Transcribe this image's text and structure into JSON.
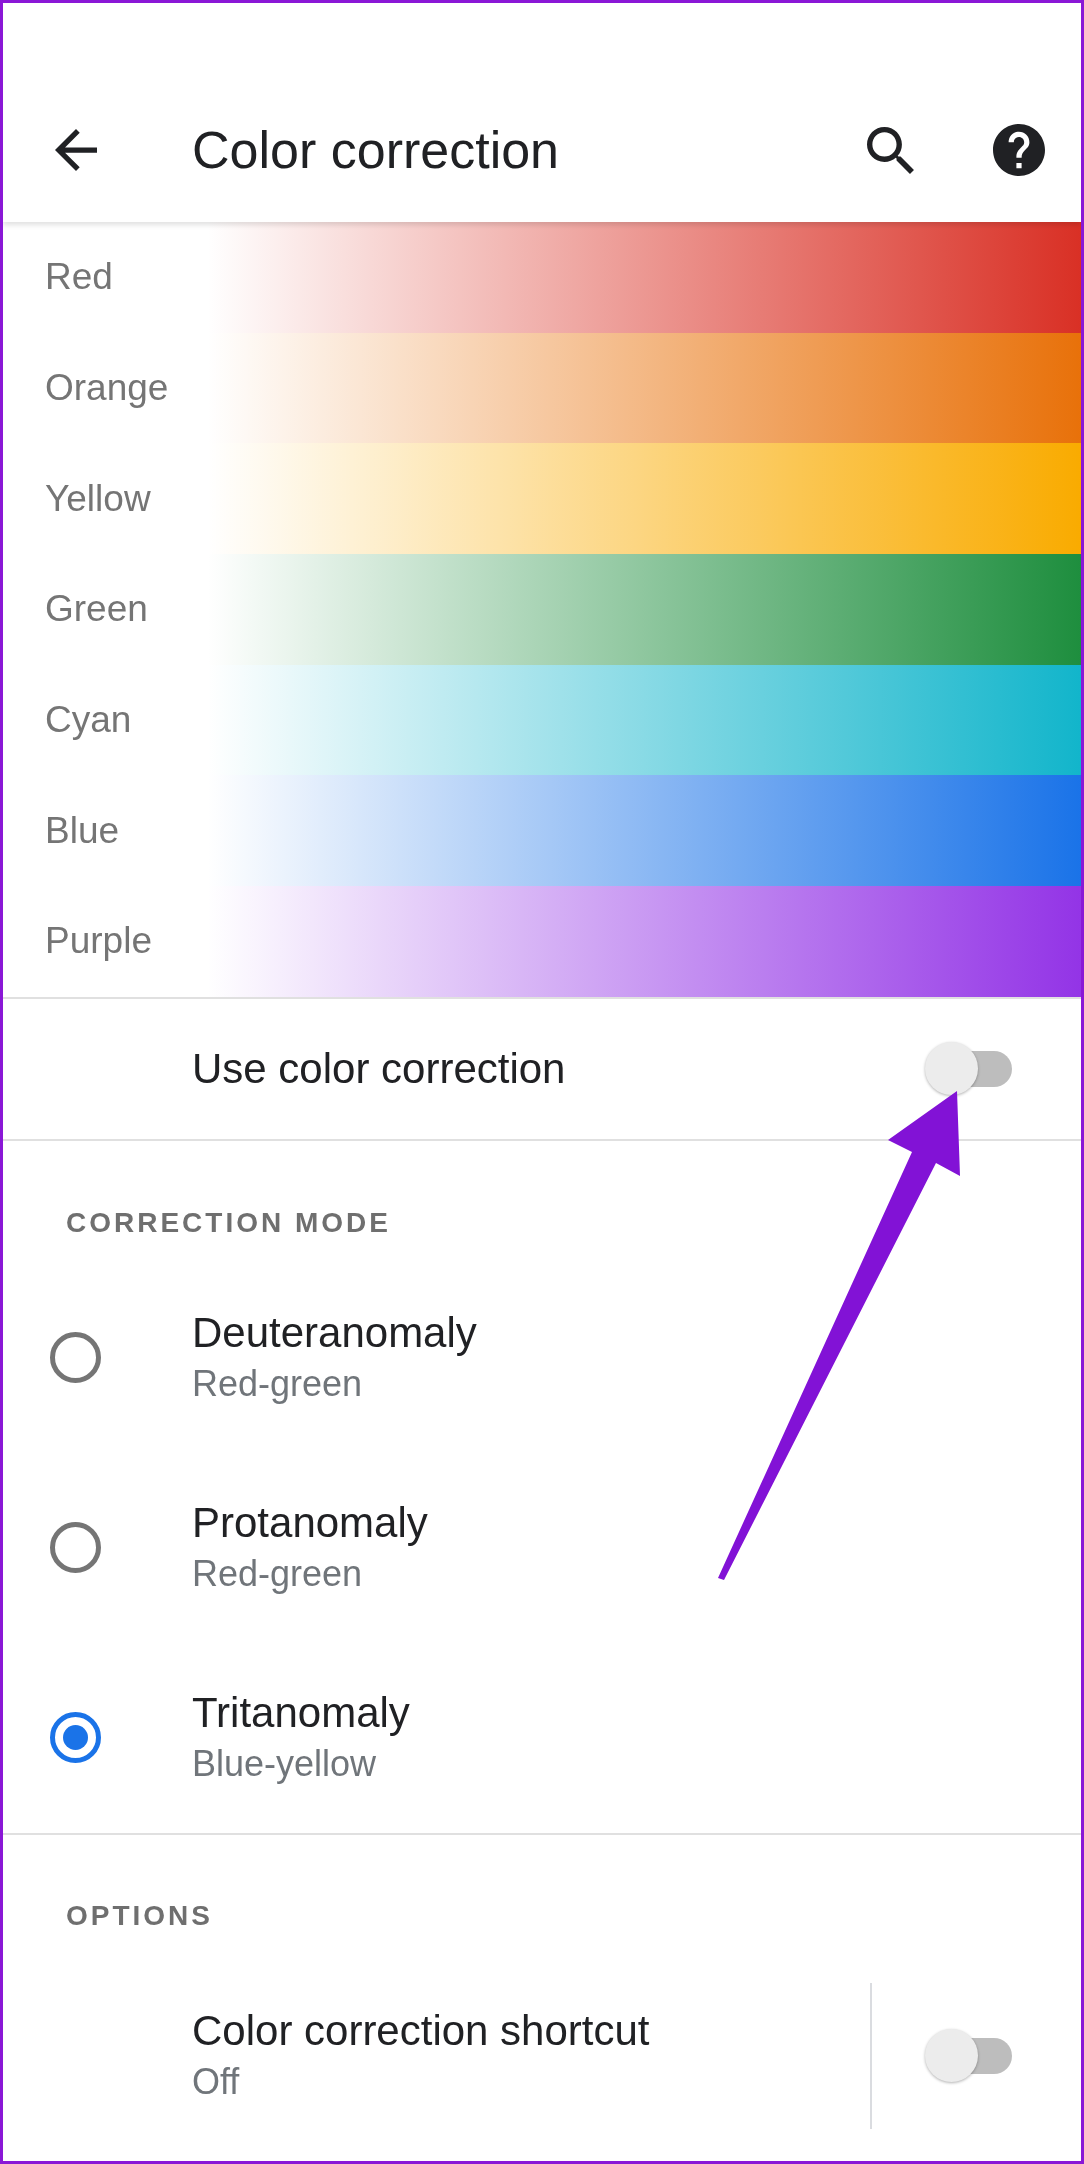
{
  "app_bar": {
    "title": "Color correction"
  },
  "preview": [
    {
      "label": "Red",
      "color": "#d93025"
    },
    {
      "label": "Orange",
      "color": "#e8710a"
    },
    {
      "label": "Yellow",
      "color": "#f9ab00"
    },
    {
      "label": "Green",
      "color": "#1e8e3e"
    },
    {
      "label": "Cyan",
      "color": "#12b5cb"
    },
    {
      "label": "Blue",
      "color": "#1a73e8"
    },
    {
      "label": "Purple",
      "color": "#9334e6"
    }
  ],
  "main_switch": {
    "label": "Use color correction",
    "on": false
  },
  "correction_mode": {
    "heading": "CORRECTION MODE",
    "options": [
      {
        "title": "Deuteranomaly",
        "subtitle": "Red-green",
        "selected": false
      },
      {
        "title": "Protanomaly",
        "subtitle": "Red-green",
        "selected": false
      },
      {
        "title": "Tritanomaly",
        "subtitle": "Blue-yellow",
        "selected": true
      }
    ]
  },
  "options": {
    "heading": "OPTIONS",
    "items": [
      {
        "title": "Color correction shortcut",
        "subtitle": "Off",
        "on": false
      }
    ]
  }
}
